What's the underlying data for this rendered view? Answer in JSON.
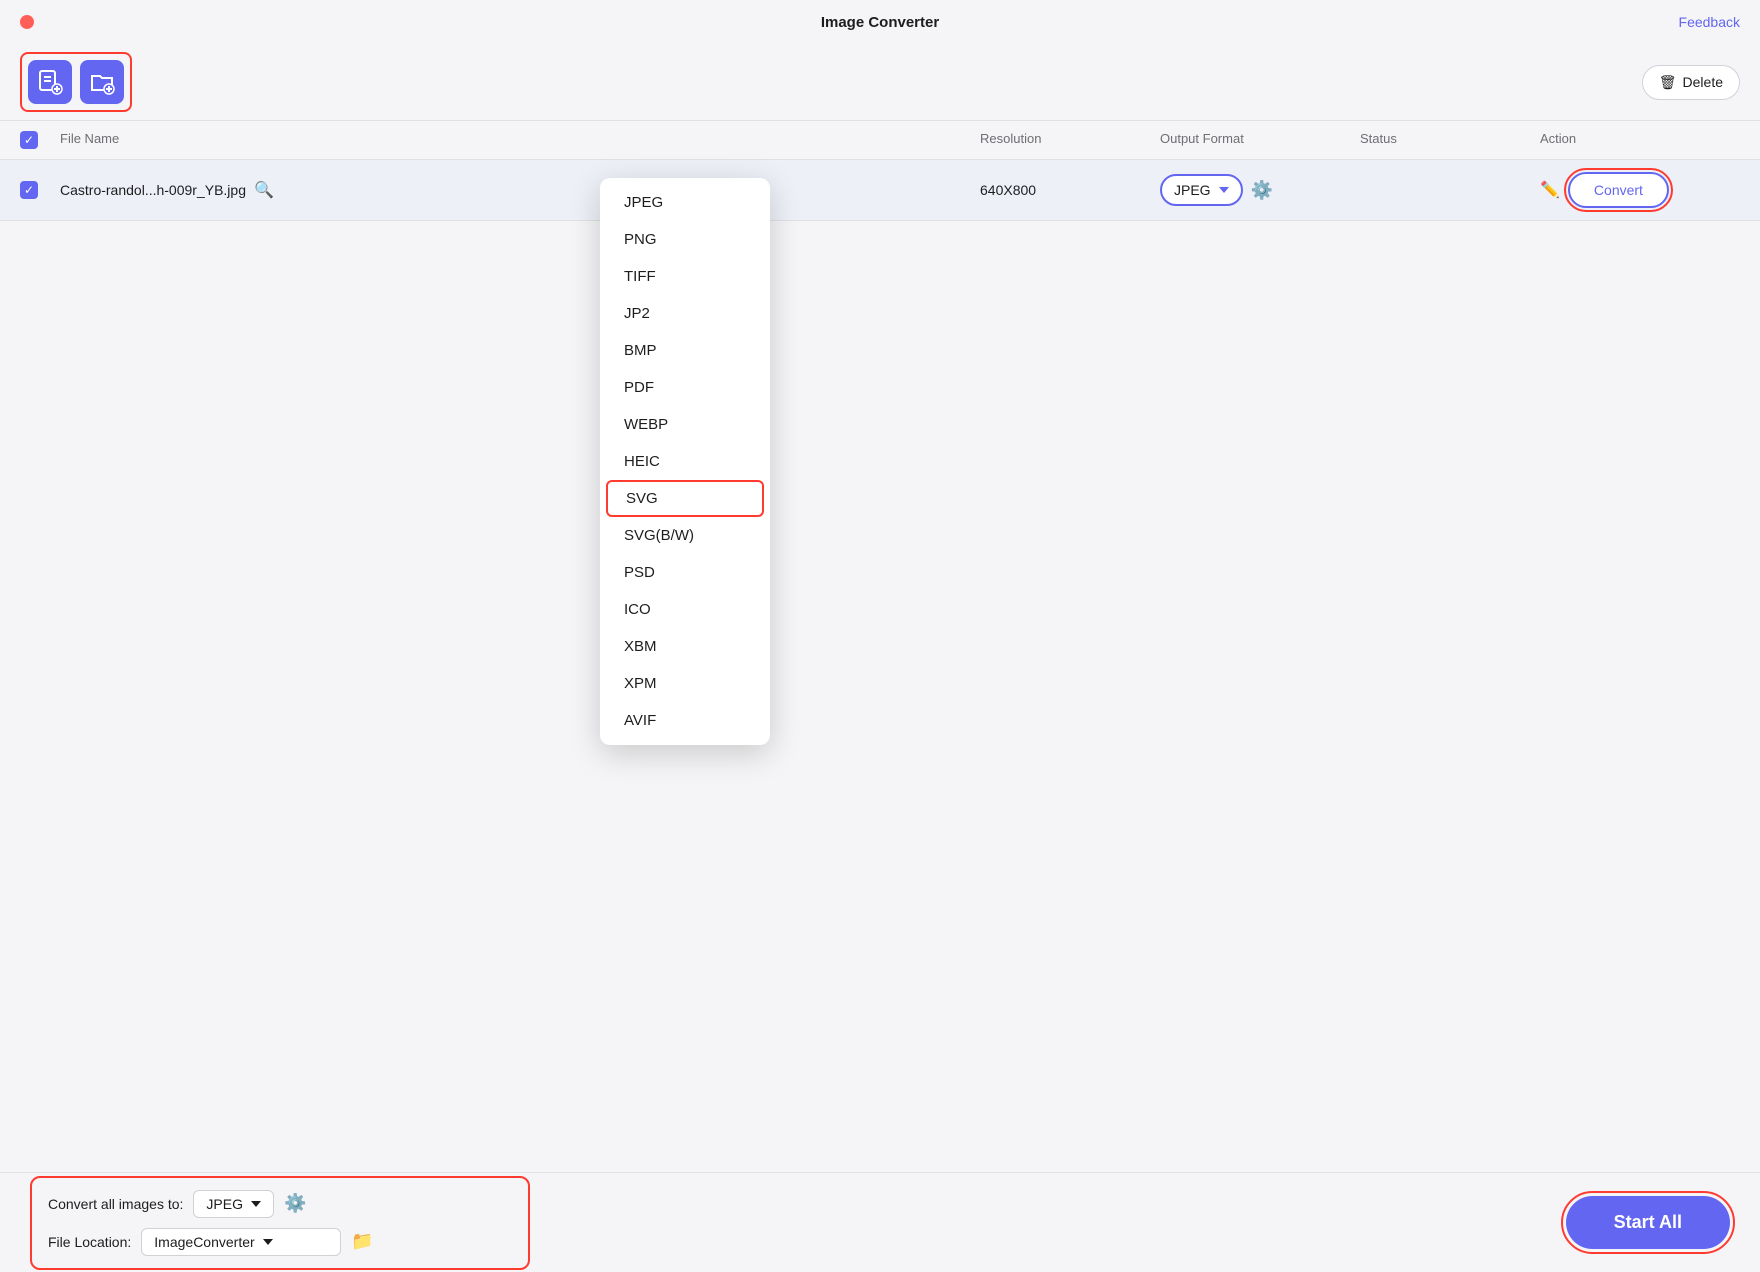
{
  "app": {
    "title": "Image Converter",
    "feedback_label": "Feedback"
  },
  "toolbar": {
    "add_file_label": "Add File",
    "add_folder_label": "Add Folder",
    "delete_label": "Delete"
  },
  "table": {
    "columns": [
      "File Name",
      "Resolution",
      "Output Format",
      "Status",
      "Action"
    ],
    "rows": [
      {
        "checked": true,
        "file_name": "Castro-randol...h-009r_YB.jpg",
        "resolution": "640X800",
        "output_format": "JPEG",
        "status": "",
        "action": "Convert"
      }
    ]
  },
  "dropdown": {
    "options": [
      "JPEG",
      "PNG",
      "TIFF",
      "JP2",
      "BMP",
      "PDF",
      "WEBP",
      "HEIC",
      "SVG",
      "SVG(B/W)",
      "PSD",
      "ICO",
      "XBM",
      "XPM",
      "AVIF"
    ],
    "highlighted": "SVG",
    "selected": "JPEG"
  },
  "bottom_bar": {
    "convert_all_label": "Convert all images to:",
    "format_selected": "JPEG",
    "file_location_label": "File Location:",
    "location_selected": "ImageConverter",
    "start_all_label": "Start  All"
  }
}
